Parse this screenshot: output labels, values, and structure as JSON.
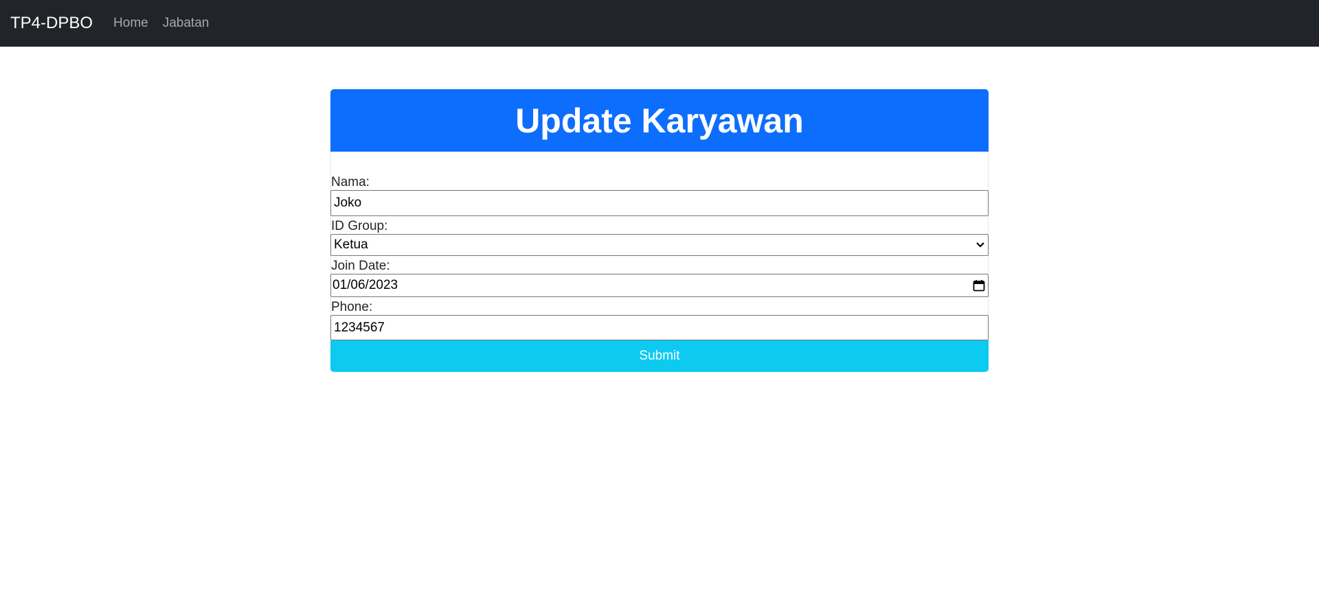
{
  "navbar": {
    "brand": "TP4-DPBO",
    "links": [
      "Home",
      "Jabatan"
    ]
  },
  "form": {
    "title": "Update Karyawan",
    "fields": {
      "nama": {
        "label": "Nama:",
        "value": "Joko"
      },
      "id_group": {
        "label": "ID Group:",
        "value": "Ketua"
      },
      "join_date": {
        "label": "Join Date:",
        "value": "01/06/2023"
      },
      "phone": {
        "label": "Phone:",
        "value": "1234567"
      }
    },
    "submit_label": "Submit"
  },
  "colors": {
    "navbar_bg": "#212529",
    "header_bg": "#0d6efd",
    "submit_bg": "#0dcaf0"
  },
  "icons": {
    "select": "chevron-down-icon",
    "date": "calendar-icon"
  }
}
